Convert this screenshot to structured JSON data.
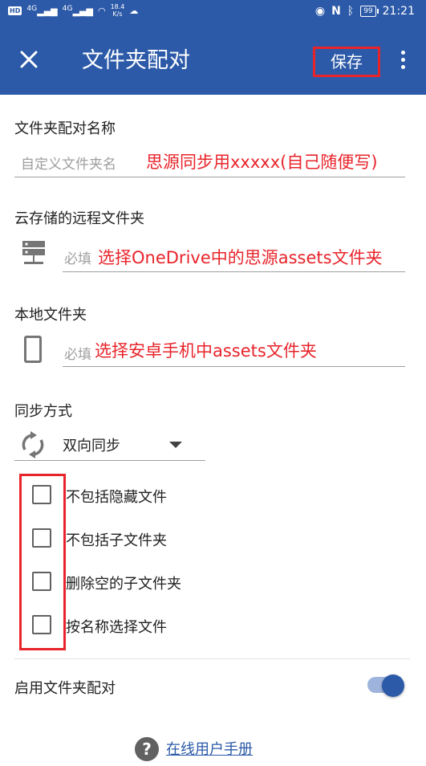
{
  "status_bar": {
    "hd_badge": "HD",
    "signal_1": "4G",
    "signal_2": "4G",
    "speed_value": "18.4",
    "speed_unit": "K/s",
    "battery": "99",
    "time": "21:21"
  },
  "app_bar": {
    "title": "文件夹配对",
    "save_label": "保存"
  },
  "pair_name": {
    "label": "文件夹配对名称",
    "placeholder": "自定义文件夹名",
    "annotation": "思源同步用xxxxx(自己随便写)"
  },
  "remote_folder": {
    "label": "云存储的远程文件夹",
    "placeholder": "必填",
    "annotation": "选择OneDrive中的思源assets文件夹"
  },
  "local_folder": {
    "label": "本地文件夹",
    "placeholder": "必填",
    "annotation": "选择安卓手机中assets文件夹"
  },
  "sync_mode": {
    "label": "同步方式",
    "value": "双向同步"
  },
  "options": [
    {
      "label": "不包括隐藏文件",
      "checked": false
    },
    {
      "label": "不包括子文件夹",
      "checked": false
    },
    {
      "label": "删除空的子文件夹",
      "checked": false
    },
    {
      "label": "按名称选择文件",
      "checked": false
    }
  ],
  "enable_pair": {
    "label": "启用文件夹配对",
    "enabled": true
  },
  "help": {
    "icon": "?",
    "link": "在线用户手册"
  },
  "colors": {
    "primary": "#2c5aa8",
    "annotation_red": "#e8242b"
  }
}
